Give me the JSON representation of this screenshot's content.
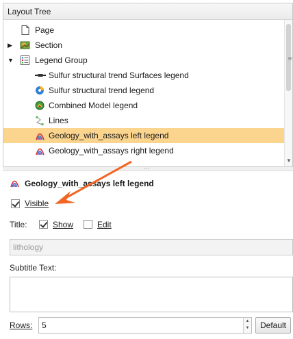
{
  "tree": {
    "header": "Layout Tree",
    "items": [
      {
        "label": "Page",
        "icon": "page-icon"
      },
      {
        "label": "Section",
        "icon": "section-icon",
        "expander": "▶"
      },
      {
        "label": "Legend Group",
        "icon": "legend-group-icon",
        "expander": "▼"
      },
      {
        "label": "Sulfur structural trend Surfaces legend",
        "icon": "surface-trend-icon"
      },
      {
        "label": "Sulfur structural trend legend",
        "icon": "trend-icon"
      },
      {
        "label": "Combined Model legend",
        "icon": "combined-model-icon"
      },
      {
        "label": "Lines",
        "icon": "lines-icon"
      },
      {
        "label": "Geology_with_assays left legend",
        "icon": "geology-legend-icon"
      },
      {
        "label": "Geology_with_assays right legend",
        "icon": "geology-legend-icon"
      }
    ],
    "selected_index": 7
  },
  "properties": {
    "title": "Geology_with_assays left legend",
    "visible": {
      "label": "Visible",
      "checked": true
    },
    "title_row": {
      "label": "Title:",
      "show": {
        "label": "Show",
        "checked": true
      },
      "edit": {
        "label": "Edit",
        "checked": false
      }
    },
    "title_value": "lithology",
    "subtitle_label": "Subtitle Text:",
    "subtitle_value": "",
    "rows": {
      "label": "Rows:",
      "value": "5"
    },
    "default_button": "Default"
  },
  "colors": {
    "selection": "#fbd48e",
    "annotation_arrow": "#f26522"
  }
}
